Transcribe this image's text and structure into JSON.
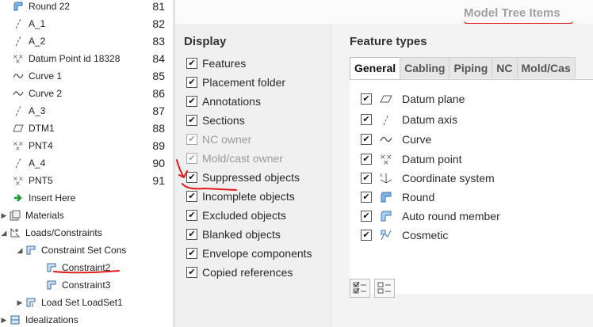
{
  "tree": {
    "items": [
      {
        "label": "Round 22",
        "icon": "round-icon",
        "num": "81"
      },
      {
        "label": "A_1",
        "icon": "axis-icon",
        "num": "82"
      },
      {
        "label": "A_2",
        "icon": "axis-icon",
        "num": "83"
      },
      {
        "label": "Datum Point id 18328",
        "icon": "datum-point-icon",
        "num": "84"
      },
      {
        "label": "Curve 1",
        "icon": "curve-icon",
        "num": "85"
      },
      {
        "label": "Curve 2",
        "icon": "curve-icon",
        "num": "86"
      },
      {
        "label": "A_3",
        "icon": "axis-icon",
        "num": "87"
      },
      {
        "label": "DTM1",
        "icon": "datum-plane-icon",
        "num": "88"
      },
      {
        "label": "PNT4",
        "icon": "datum-point-icon",
        "num": "89"
      },
      {
        "label": "A_4",
        "icon": "axis-icon",
        "num": "90"
      },
      {
        "label": "PNT5",
        "icon": "datum-point-icon",
        "num": "91"
      },
      {
        "label": "Insert Here",
        "icon": "insert-arrow-icon",
        "num": ""
      },
      {
        "label": "Materials",
        "icon": "materials-icon",
        "num": ""
      },
      {
        "label": "Loads/Constraints",
        "icon": "loads-icon",
        "num": ""
      },
      {
        "label": "Constraint Set Cons",
        "icon": "constraint-set-icon",
        "num": ""
      },
      {
        "label": "Constraint2",
        "icon": "constraint-icon",
        "num": ""
      },
      {
        "label": "Constraint3",
        "icon": "constraint-icon",
        "num": ""
      },
      {
        "label": "Load Set LoadSet1",
        "icon": "load-set-icon",
        "num": ""
      },
      {
        "label": "Idealizations",
        "icon": "idealizations-icon",
        "num": ""
      }
    ]
  },
  "dialog": {
    "title": "Model Tree Items",
    "display": {
      "heading": "Display",
      "options": [
        {
          "label": "Features",
          "checked": true,
          "enabled": true
        },
        {
          "label": "Placement folder",
          "checked": true,
          "enabled": true
        },
        {
          "label": "Annotations",
          "checked": true,
          "enabled": true
        },
        {
          "label": "Sections",
          "checked": true,
          "enabled": true
        },
        {
          "label": "NC owner",
          "checked": true,
          "enabled": false
        },
        {
          "label": "Mold/cast owner",
          "checked": true,
          "enabled": false
        },
        {
          "label": "Suppressed objects",
          "checked": true,
          "enabled": true
        },
        {
          "label": "Incomplete objects",
          "checked": true,
          "enabled": true
        },
        {
          "label": "Excluded objects",
          "checked": true,
          "enabled": true
        },
        {
          "label": "Blanked objects",
          "checked": true,
          "enabled": true
        },
        {
          "label": "Envelope components",
          "checked": true,
          "enabled": true
        },
        {
          "label": "Copied references",
          "checked": true,
          "enabled": true
        }
      ]
    },
    "features": {
      "heading": "Feature types",
      "tabs": [
        "General",
        "Cabling",
        "Piping",
        "NC",
        "Mold/Cas"
      ],
      "active_tab": "General",
      "types": [
        {
          "label": "Datum plane",
          "icon": "datum-plane-icon",
          "checked": true
        },
        {
          "label": "Datum axis",
          "icon": "datum-axis-icon",
          "checked": true
        },
        {
          "label": "Curve",
          "icon": "curve-icon",
          "checked": true
        },
        {
          "label": "Datum point",
          "icon": "datum-point-icon",
          "checked": true
        },
        {
          "label": "Coordinate system",
          "icon": "coordinate-system-icon",
          "checked": true
        },
        {
          "label": "Round",
          "icon": "round-icon",
          "checked": true
        },
        {
          "label": "Auto round member",
          "icon": "auto-round-icon",
          "checked": true
        },
        {
          "label": "Cosmetic",
          "icon": "cosmetic-icon",
          "checked": true
        }
      ],
      "buttons": [
        {
          "name": "select-all-button",
          "icon": "select-all-icon"
        },
        {
          "name": "deselect-all-button",
          "icon": "deselect-all-icon"
        }
      ]
    }
  },
  "colors": {
    "annotation_red": "#e31b1b",
    "title_gray": "#a0a0a0"
  }
}
